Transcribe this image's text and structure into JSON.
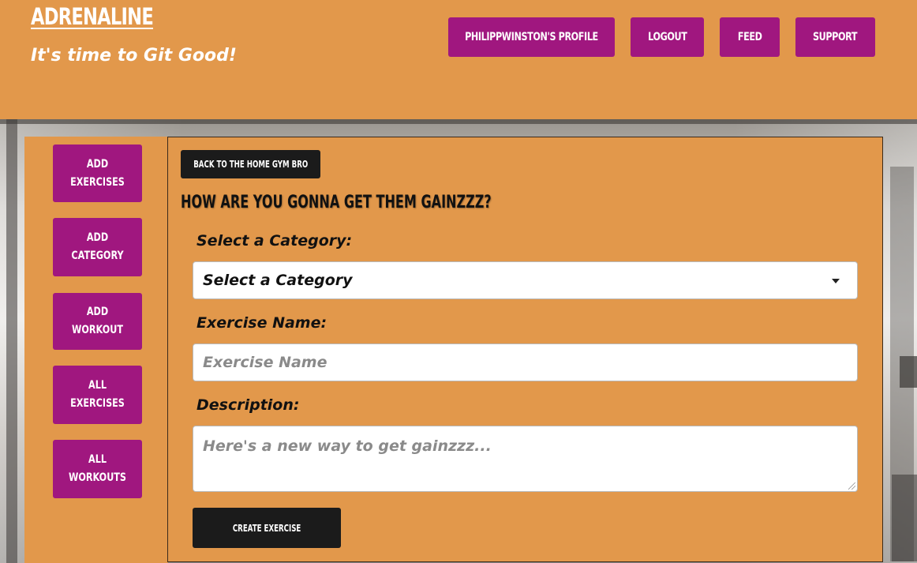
{
  "header": {
    "brand": "Adrenaline",
    "tagline": "It's time to Git Good!",
    "nav": [
      {
        "label": "PhilippWinston's Profile"
      },
      {
        "label": "Logout"
      },
      {
        "label": "Feed"
      },
      {
        "label": "Support"
      }
    ]
  },
  "sidebar": {
    "items": [
      {
        "label": "Add Exercises"
      },
      {
        "label": "Add Category"
      },
      {
        "label": "Add Workout"
      },
      {
        "label": "All Exercises"
      },
      {
        "label": "All Workouts"
      }
    ]
  },
  "form": {
    "back_label": "Back to the Home Gym Bro",
    "title": "How are you gonna get them gainzzz?",
    "category_label": "Select a Category:",
    "category_value": "Select a Category",
    "name_label": "Exercise Name:",
    "name_placeholder": "Exercise Name",
    "description_label": "Description:",
    "description_placeholder": "Here's a new way to get gainzzz...",
    "submit_label": "Create Exercise"
  },
  "colors": {
    "background": "#e2984b",
    "button_primary": "#a0177f",
    "button_dark": "#1b1b1b",
    "text_light": "#ffffff"
  },
  "icons": {
    "select_caret": "caret-down-icon"
  }
}
